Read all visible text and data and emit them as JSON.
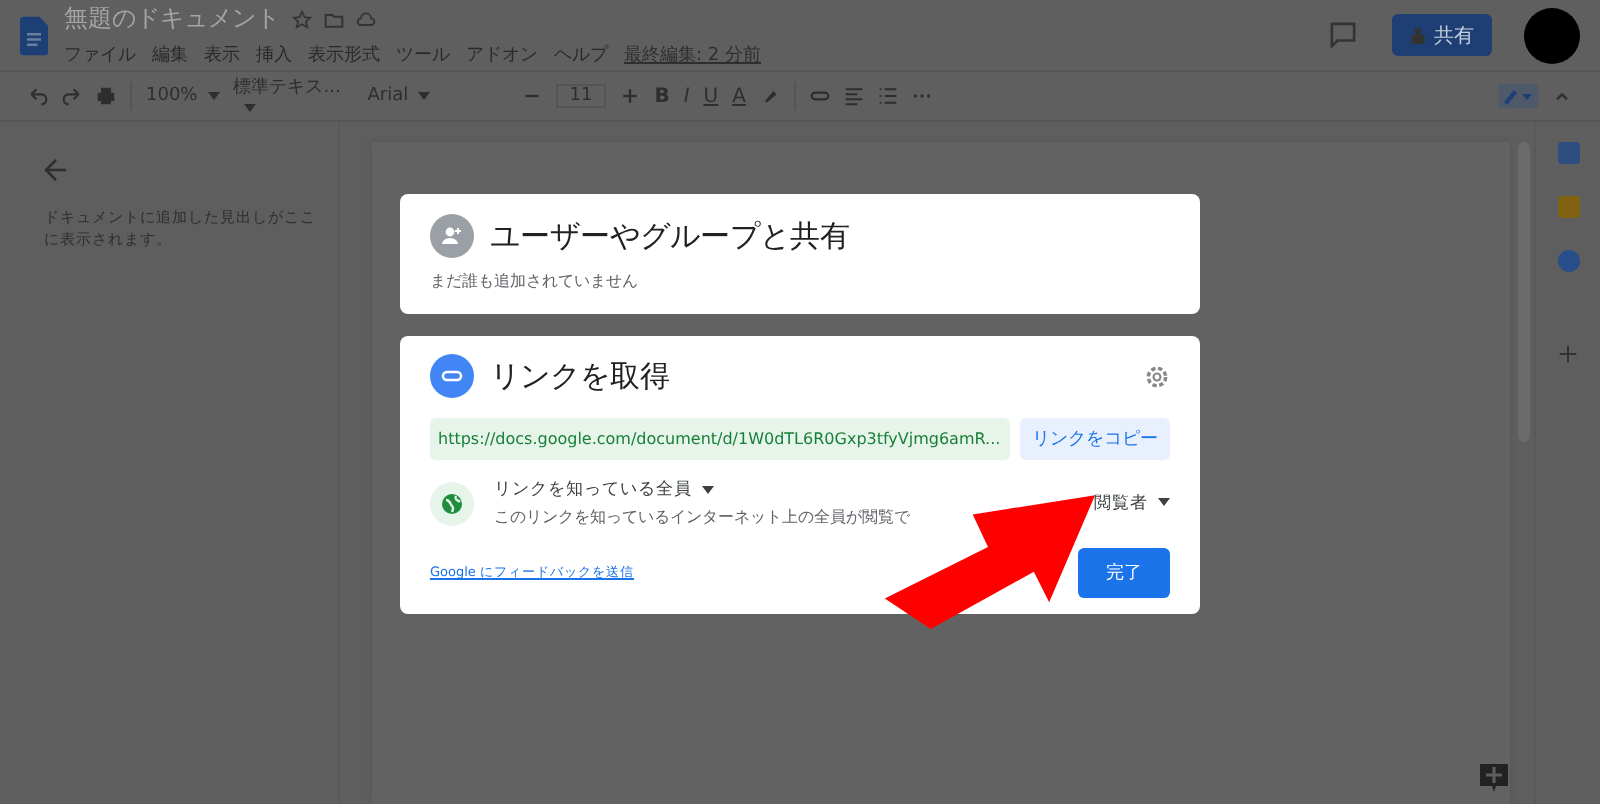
{
  "doc": {
    "title": "無題のドキュメント",
    "menus": [
      "ファイル",
      "編集",
      "表示",
      "挿入",
      "表示形式",
      "ツール",
      "アドオン",
      "ヘルプ"
    ],
    "last_edit": "最終編集: 2 分前",
    "share_button": "共有"
  },
  "toolbar": {
    "zoom": "100%",
    "style": "標準テキス...",
    "font": "Arial",
    "size": "11",
    "format": [
      {
        "kind": "bold",
        "label": "B"
      },
      {
        "kind": "italic",
        "label": "I"
      },
      {
        "kind": "underline",
        "label": "U"
      },
      {
        "kind": "color",
        "label": "A"
      }
    ]
  },
  "outline": {
    "hint": "ドキュメントに追加した見出しがここに表示されます。"
  },
  "share_dialog": {
    "title": "ユーザーやグループと共有",
    "note": "まだ誰も追加されていません"
  },
  "link_dialog": {
    "title": "リンクを取得",
    "url": "https://docs.google.com/document/d/1W0dTL6R0Gxp3tfyVjmg6amR...",
    "copy_button": "リンクをコピー",
    "access": "リンクを知っている全員",
    "access_desc": "このリンクを知っているインターネット上の全員が閲覧で",
    "role": "閲覧者",
    "feedback_link": "Google にフィードバックを送信",
    "done_button": "完了"
  }
}
